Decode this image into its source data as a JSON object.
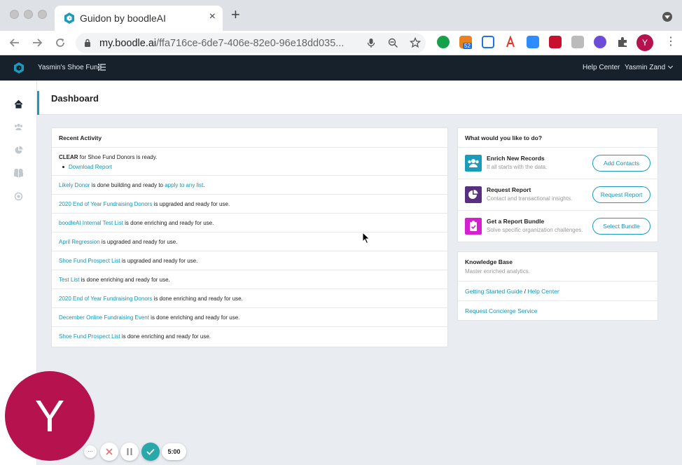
{
  "browser": {
    "tab_title": "Guidon by boodleAI",
    "tab_close": "×",
    "new_tab": "+",
    "url_domain": "my.boodle.ai",
    "url_path": "/ffa716ce-6de7-406e-82e0-96e18dd035...",
    "extension_badge": "52",
    "profile_initial": "Y"
  },
  "app": {
    "org_name": "Yasmin's Shoe Fund",
    "help_center": "Help Center",
    "user_name": "Yasmin Zand"
  },
  "page": {
    "title": "Dashboard"
  },
  "recent_activity": {
    "title": "Recent Activity",
    "first": {
      "name": "CLEAR",
      "text": " for Shoe Fund Donors is ready.",
      "sub_link": "Download Report"
    },
    "rows": [
      {
        "link": "Likely Donor",
        "text": " is done building and ready to ",
        "link2": "apply to any list",
        "tail": "."
      },
      {
        "link": "2020 End of Year Fundraising Donors",
        "text": " is upgraded and ready for use."
      },
      {
        "link": "boodleAI Internal Test List",
        "text": " is done enriching and ready for use."
      },
      {
        "link": "April Regression",
        "text": " is upgraded and ready for use."
      },
      {
        "link": "Shoe Fund Prospect List",
        "text": " is upgraded and ready for use."
      },
      {
        "link": "Test List",
        "text": " is done enriching and ready for use."
      },
      {
        "link": "2020 End of Year Fundraising Donors",
        "text": " is done enriching and ready for use."
      },
      {
        "link": "December Online Fundraising Event",
        "text": " is done enriching and ready for use."
      },
      {
        "link": "Shoe Fund Prospect List",
        "text": " is done enriching and ready for use."
      }
    ]
  },
  "todo": {
    "title": "What would you like to do?",
    "items": [
      {
        "title": "Enrich New Records",
        "subtitle": "It all starts with the data.",
        "button": "Add Contacts",
        "color": "#1a9bb9"
      },
      {
        "title": "Request Report",
        "subtitle": "Contact and transactional insights.",
        "button": "Request Report",
        "color": "#5a2f80"
      },
      {
        "title": "Get a Report Bundle",
        "subtitle": "Solve specific organization challenges.",
        "button": "Select Bundle",
        "color": "#d61fd1"
      }
    ]
  },
  "knowledge_base": {
    "title": "Knowledge Base",
    "subtitle": "Master enriched analytics.",
    "link_guide": "Getting Started Guide",
    "separator": " / ",
    "link_help": "Help Center",
    "link_concierge": "Request Concierge Service"
  },
  "recorder": {
    "avatar_initial": "Y",
    "more": "···",
    "timer": "5:00"
  },
  "colors": {
    "accent": "#1a9bb9",
    "header_bg": "#17212b",
    "avatar": "#b5124e",
    "confirm": "#28a8a8"
  }
}
